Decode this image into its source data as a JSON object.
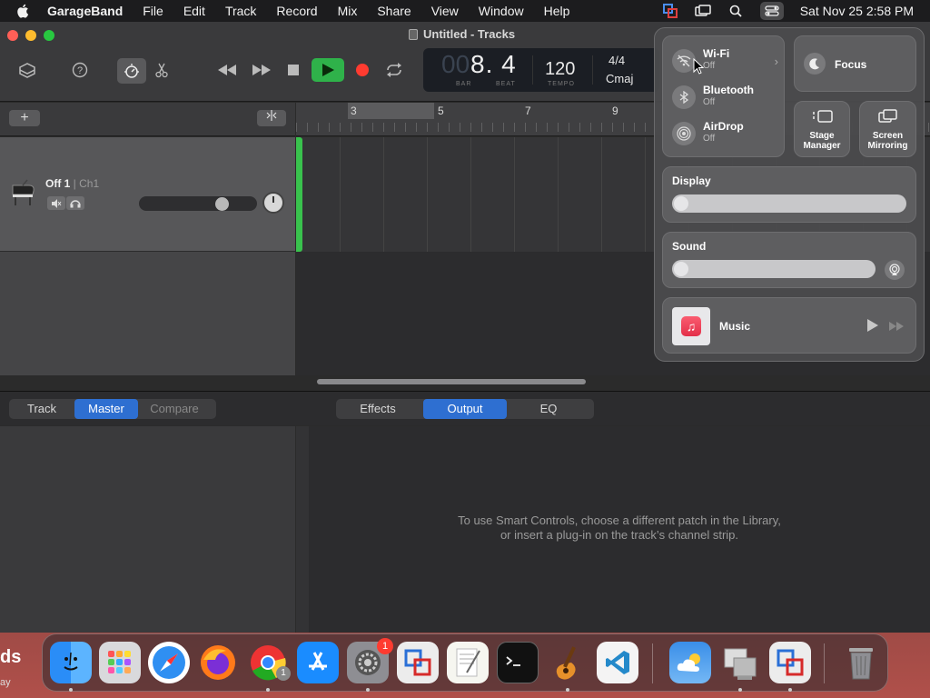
{
  "menubar": {
    "app_name": "GarageBand",
    "menus": [
      "File",
      "Edit",
      "Track",
      "Record",
      "Mix",
      "Share",
      "View",
      "Window",
      "Help"
    ],
    "clock": "Sat Nov 25  2:58 PM"
  },
  "window": {
    "title": "Untitled - Tracks"
  },
  "lcd": {
    "position_dim": "00",
    "position": "8. 4",
    "bar_label": "BAR",
    "beat_label": "BEAT",
    "tempo": "120",
    "tempo_label": "TEMPO",
    "time_signature": "4/4",
    "key": "Cmaj"
  },
  "track": {
    "name": "Off 1",
    "channel": " | Ch1"
  },
  "ruler": {
    "markers": [
      "3",
      "5",
      "7",
      "9"
    ]
  },
  "editor": {
    "left_tabs": [
      "Track",
      "Master",
      "Compare"
    ],
    "left_selected": "Master",
    "right_tabs": [
      "Effects",
      "Output",
      "EQ"
    ],
    "right_selected": "Output",
    "message_line1": "To use Smart Controls, choose a different patch in the Library,",
    "message_line2": "or insert a plug-in on the track’s channel strip."
  },
  "control_center": {
    "wifi": {
      "label": "Wi-Fi",
      "state": "Off"
    },
    "bluetooth": {
      "label": "Bluetooth",
      "state": "Off"
    },
    "airdrop": {
      "label": "AirDrop",
      "state": "Off"
    },
    "focus": "Focus",
    "stage_manager": "Stage Manager",
    "stage_manager_l1": "Stage",
    "stage_manager_l2": "Manager",
    "screen_mirroring_l1": "Screen",
    "screen_mirroring_l2": "Mirroring",
    "display": "Display",
    "sound": "Sound",
    "music": "Music"
  },
  "dock": {
    "apps": [
      "Finder",
      "Launchpad",
      "Safari",
      "Firefox",
      "Chrome",
      "App Store",
      "System Settings",
      "Remote Desktop",
      "TextEdit",
      "Terminal",
      "GarageBand",
      "VS Code",
      "Weather",
      "Migration Assistant",
      "Remote Desktop 2",
      "Trash"
    ],
    "chrome_badge": "1",
    "settings_badge": "1"
  },
  "desktop": {
    "text1": "ds",
    "text2": "ay"
  },
  "colors": {
    "accent": "#2e6fd1",
    "play_green": "#2fb24a",
    "record_red": "#ff3b30",
    "playhead": "#39c24d"
  }
}
